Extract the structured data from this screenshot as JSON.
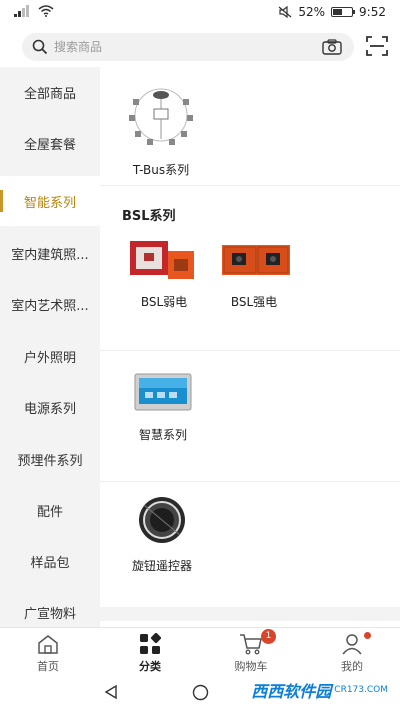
{
  "status_bar": {
    "battery_text": "52%",
    "battery_level": 0.52,
    "time": "9:52"
  },
  "search": {
    "placeholder": "搜索商品"
  },
  "sidebar": {
    "items": [
      {
        "label": "全部商品",
        "active": false
      },
      {
        "label": "全屋套餐",
        "active": false
      },
      {
        "label": "智能系列",
        "active": true
      },
      {
        "label": "室内建筑照...",
        "active": false
      },
      {
        "label": "室内艺术照...",
        "active": false
      },
      {
        "label": "户外照明",
        "active": false
      },
      {
        "label": "电源系列",
        "active": false
      },
      {
        "label": "预埋件系列",
        "active": false
      },
      {
        "label": "配件",
        "active": false
      },
      {
        "label": "样品包",
        "active": false
      },
      {
        "label": "广宣物料",
        "active": false
      }
    ]
  },
  "content": {
    "tbus": {
      "label": "T-Bus系列"
    },
    "bsl_section": {
      "title": "BSL系列",
      "items": [
        {
          "label": "BSL弱电"
        },
        {
          "label": "BSL强电"
        }
      ]
    },
    "smart": {
      "label": "智慧系列"
    },
    "knob": {
      "label": "旋钮遥控器"
    }
  },
  "tabbar": {
    "tabs": [
      {
        "label": "首页",
        "icon": "home-icon"
      },
      {
        "label": "分类",
        "icon": "category-icon",
        "active": true
      },
      {
        "label": "购物车",
        "icon": "cart-icon",
        "badge": "1"
      },
      {
        "label": "我的",
        "icon": "profile-icon"
      }
    ]
  },
  "watermark": {
    "brand": "西西软件园",
    "url": "CR173.COM"
  },
  "colors": {
    "accent": "#c8962a",
    "badge": "#d9452b",
    "panel_orange": "#e8571f",
    "panel_red": "#c4272a"
  }
}
